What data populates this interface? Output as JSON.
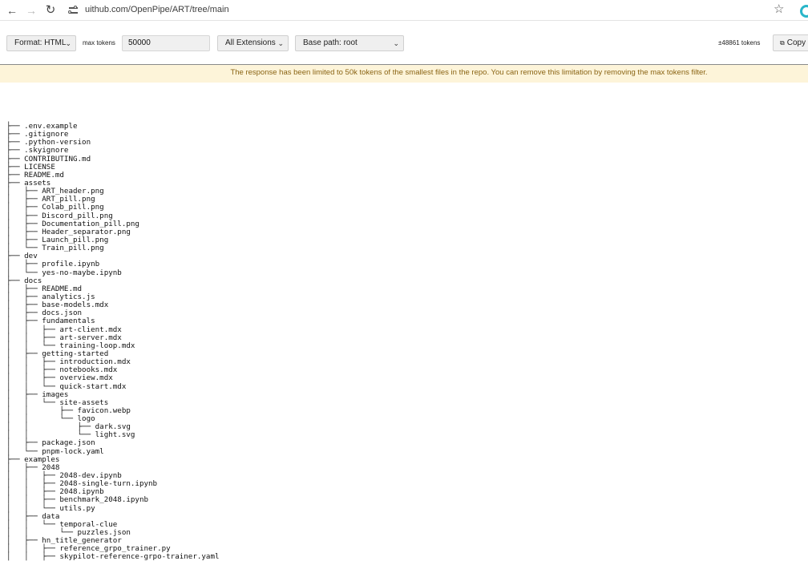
{
  "browser": {
    "back_icon": "←",
    "forward_icon": "→",
    "reload_icon": "↻",
    "url": "uithub.com/OpenPipe/ART/tree/main",
    "star_icon": "☆"
  },
  "toolbar": {
    "format": {
      "selected": "Format: HTML"
    },
    "max_tokens": {
      "label": "max tokens",
      "value": "50000"
    },
    "extensions": {
      "selected": "All Extensions"
    },
    "base_path": {
      "selected": "Base path: root"
    },
    "token_count": "±48861 tokens",
    "copy_label": "Copy",
    "chevron": "⌄"
  },
  "banner": {
    "text": "The response has been limited to 50k tokens of the smallest files in the repo. You can remove this limitation by removing the max tokens filter.",
    "color": "#8a6414",
    "background": "#fdf4d9"
  },
  "tree": [
    "├── .env.example",
    "├── .gitignore",
    "├── .python-version",
    "├── .skyignore",
    "├── CONTRIBUTING.md",
    "├── LICENSE",
    "├── README.md",
    "├── assets",
    "│   ├── ART_header.png",
    "│   ├── ART_pill.png",
    "│   ├── Colab_pill.png",
    "│   ├── Discord_pill.png",
    "│   ├── Documentation_pill.png",
    "│   ├── Header_separator.png",
    "│   ├── Launch_pill.png",
    "│   └── Train_pill.png",
    "├── dev",
    "│   ├── profile.ipynb",
    "│   └── yes-no-maybe.ipynb",
    "├── docs",
    "│   ├── README.md",
    "│   ├── analytics.js",
    "│   ├── base-models.mdx",
    "│   ├── docs.json",
    "│   ├── fundamentals",
    "│   │   ├── art-client.mdx",
    "│   │   ├── art-server.mdx",
    "│   │   └── training-loop.mdx",
    "│   ├── getting-started",
    "│   │   ├── introduction.mdx",
    "│   │   ├── notebooks.mdx",
    "│   │   ├── overview.mdx",
    "│   │   └── quick-start.mdx",
    "│   ├── images",
    "│   │   └── site-assets",
    "│   │       ├── favicon.webp",
    "│   │       └── logo",
    "│   │           ├── dark.svg",
    "│   │           └── light.svg",
    "│   ├── package.json",
    "│   └── pnpm-lock.yaml",
    "├── examples",
    "│   ├── 2048",
    "│   │   ├── 2048-dev.ipynb",
    "│   │   ├── 2048-single-turn.ipynb",
    "│   │   ├── 2048.ipynb",
    "│   │   ├── benchmark_2048.ipynb",
    "│   │   └── utils.py",
    "│   ├── data",
    "│   │   └── temporal-clue",
    "│   │       └── puzzles.json",
    "│   ├── hn_title_generator",
    "│   │   ├── reference_grpo_trainer.py",
    "│   │   ├── skypilot-reference-grpo-trainer.yaml"
  ]
}
